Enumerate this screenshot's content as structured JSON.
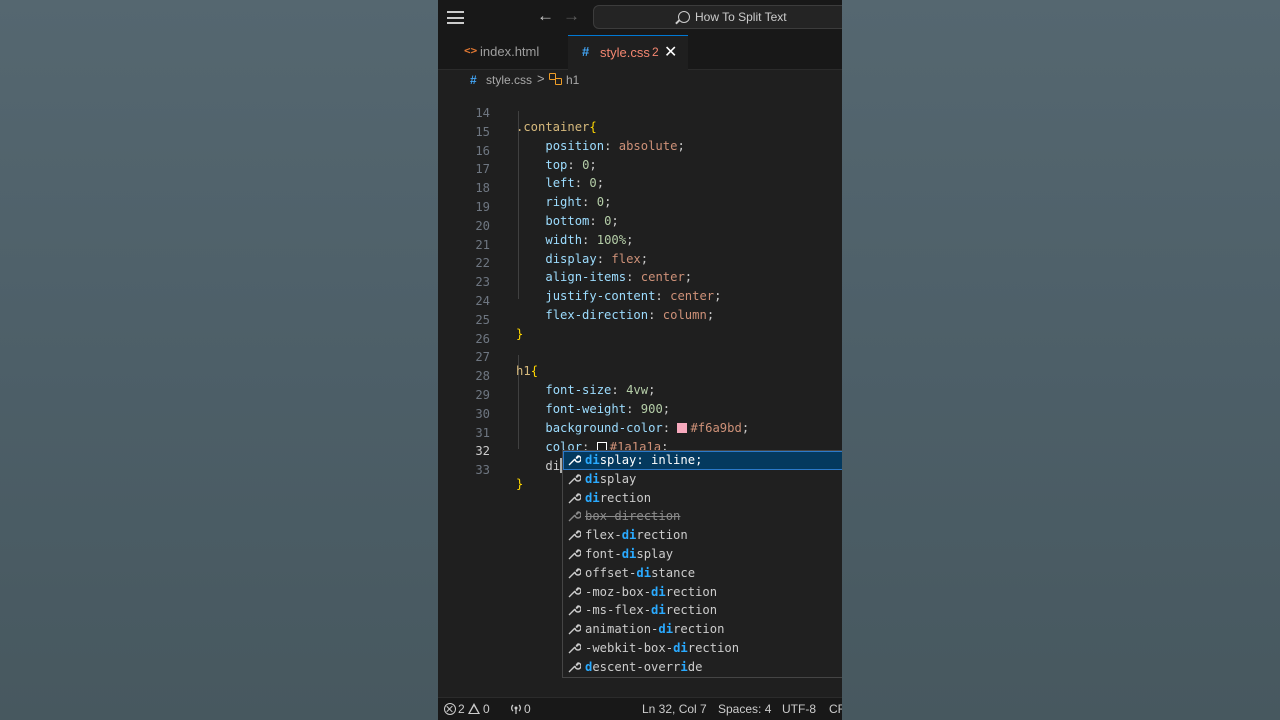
{
  "titlebar": {
    "search_text": "How To Split Text"
  },
  "tabs": [
    {
      "label": "index.html",
      "icon": "html-file-icon",
      "active": false
    },
    {
      "label": "style.css",
      "icon": "css-file-icon",
      "active": true,
      "problems": "2"
    }
  ],
  "breadcrumb": {
    "file": "style.css",
    "separator": ">",
    "symbol": "h1"
  },
  "editor": {
    "cursor_line": "32",
    "lines": [
      {
        "n": "14",
        "tokens": [
          ".container",
          "{"
        ]
      },
      {
        "n": "15",
        "prop": "position",
        "value": "absolute"
      },
      {
        "n": "16",
        "prop": "top",
        "value": "0"
      },
      {
        "n": "17",
        "prop": "left",
        "value": "0"
      },
      {
        "n": "18",
        "prop": "right",
        "value": "0"
      },
      {
        "n": "19",
        "prop": "bottom",
        "value": "0"
      },
      {
        "n": "20",
        "prop": "width",
        "value": "100%"
      },
      {
        "n": "21",
        "prop": "display",
        "value": "flex"
      },
      {
        "n": "22",
        "prop": "align-items",
        "value": "center"
      },
      {
        "n": "23",
        "prop": "justify-content",
        "value": "center"
      },
      {
        "n": "24",
        "prop": "flex-direction",
        "value": "column"
      },
      {
        "n": "25",
        "text": "}"
      },
      {
        "n": "26",
        "text": ""
      },
      {
        "n": "27",
        "tokens": [
          "h1",
          "{"
        ]
      },
      {
        "n": "28",
        "prop": "font-size",
        "value": "4vw"
      },
      {
        "n": "29",
        "prop": "font-weight",
        "value": "900"
      },
      {
        "n": "30",
        "prop": "background-color",
        "value": "#f6a9bd",
        "swatch": "#f6a9bd"
      },
      {
        "n": "31",
        "prop": "color",
        "value": "#1a1a1a",
        "swatch": "#1a1a1a"
      },
      {
        "n": "32",
        "typed": "di"
      },
      {
        "n": "33",
        "text": "}"
      }
    ]
  },
  "suggestions": [
    {
      "pre": "",
      "match": "di",
      "post": "splay: inline;",
      "selected": true
    },
    {
      "pre": "",
      "match": "di",
      "post": "splay"
    },
    {
      "pre": "",
      "match": "di",
      "post": "rection"
    },
    {
      "pre": "",
      "match": "",
      "post": "box-direction",
      "deprecated": true
    },
    {
      "pre": "flex-",
      "match": "di",
      "post": "rection"
    },
    {
      "pre": "font-",
      "match": "di",
      "post": "splay"
    },
    {
      "pre": "offset-",
      "match": "di",
      "post": "stance"
    },
    {
      "pre": "-moz-box-",
      "match": "di",
      "post": "rection"
    },
    {
      "pre": "-ms-flex-",
      "match": "di",
      "post": "rection"
    },
    {
      "pre": "animation-",
      "match": "di",
      "post": "rection"
    },
    {
      "pre": "-webkit-box-",
      "match": "di",
      "post": "rection"
    },
    {
      "pre": "",
      "match": "d",
      "post": "escent-overr",
      "match2": "i",
      "post2": "de"
    }
  ],
  "statusbar": {
    "errors": "2",
    "warnings": "0",
    "ports": "0",
    "position": "Ln 32, Col 7",
    "spaces": "Spaces: 4",
    "encoding": "UTF-8",
    "eol": "CR"
  },
  "colors": {
    "accent": "#0078d4",
    "swatch_pink": "#f6a9bd",
    "swatch_dark": "#1a1a1a"
  }
}
